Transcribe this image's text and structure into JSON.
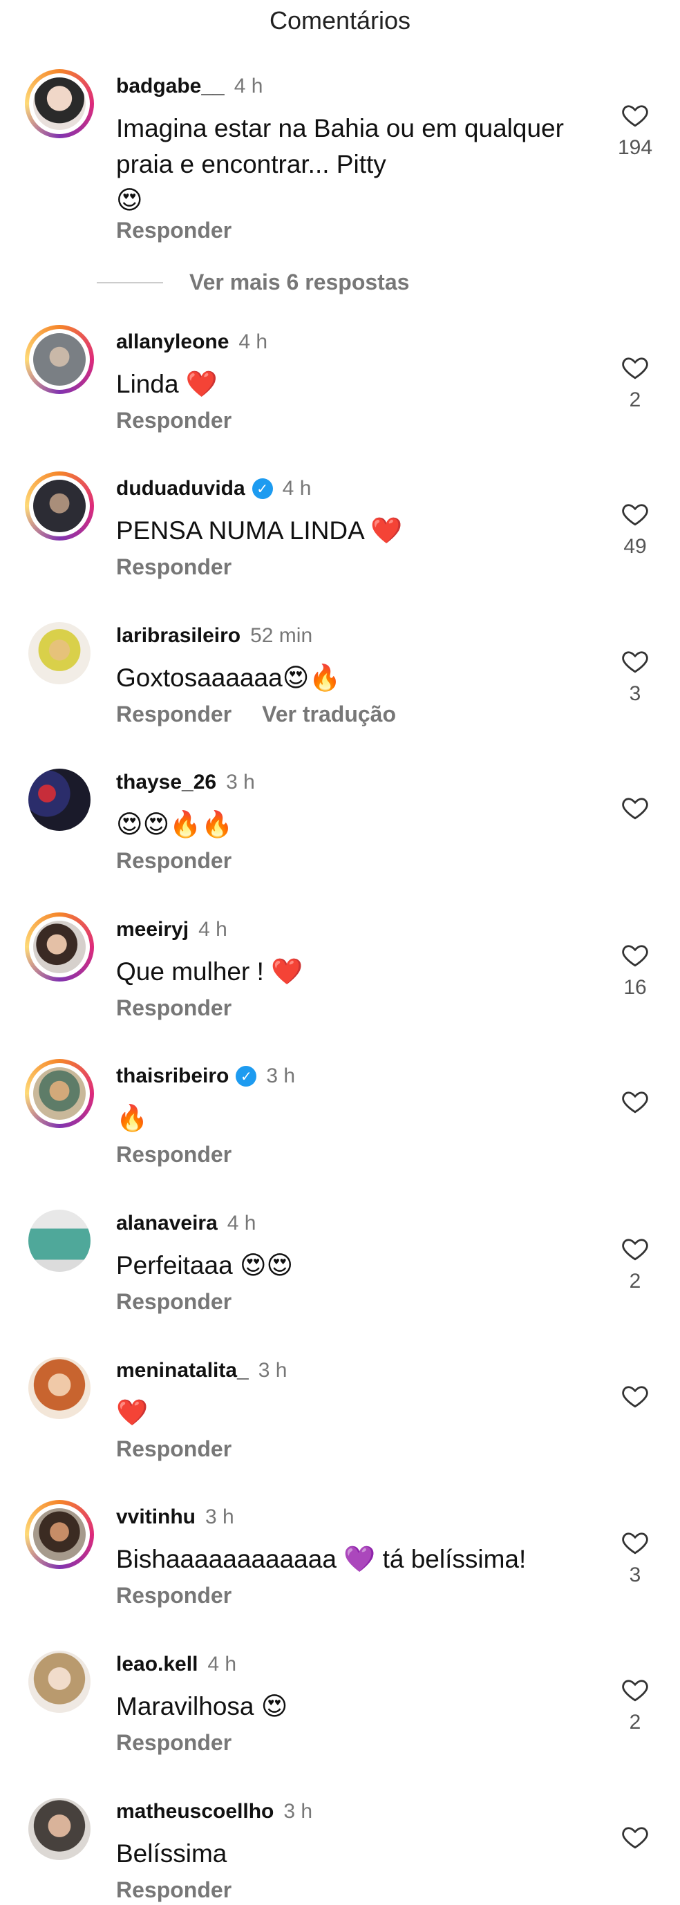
{
  "header": {
    "title": "Comentários"
  },
  "more_replies": "Ver mais 6 respostas",
  "reply_label": "Responder",
  "translate_label": "Ver tradução",
  "comments": [
    {
      "username": "badgabe__",
      "time": "4 h",
      "verified": false,
      "text": "Imagina estar na Bahia ou em qualquer praia e encontrar... Pitty",
      "emoji_line": "😍",
      "likes": "194"
    },
    {
      "username": "allanyleone",
      "time": "4 h",
      "verified": false,
      "text": "Linda",
      "emoji": "❤️",
      "likes": "2"
    },
    {
      "username": "duduaduvida",
      "time": "4 h",
      "verified": true,
      "text": "PENSA NUMA LINDA",
      "emoji": "❤️",
      "likes": "49"
    },
    {
      "username": "laribrasileiro",
      "time": "52 min",
      "verified": false,
      "text": "Goxtosaaaaaa",
      "emoji": "😍🔥",
      "likes": "3"
    },
    {
      "username": "thayse_26",
      "time": "3 h",
      "verified": false,
      "text": "",
      "emoji": "😍😍🔥🔥",
      "likes": ""
    },
    {
      "username": "meeiryj",
      "time": "4 h",
      "verified": false,
      "text": "Que mulher !",
      "emoji": "❤️",
      "likes": "16"
    },
    {
      "username": "thaisribeiro",
      "time": "3 h",
      "verified": true,
      "text": "",
      "emoji": "🔥",
      "likes": ""
    },
    {
      "username": "alanaveira",
      "time": "4 h",
      "verified": false,
      "text": "Perfeitaaa",
      "emoji": "😍😍",
      "likes": "2"
    },
    {
      "username": "meninatalita_",
      "time": "3 h",
      "verified": false,
      "text": "",
      "emoji": "❤️",
      "likes": ""
    },
    {
      "username": "vvitinhu",
      "time": "3 h",
      "verified": false,
      "text": "Bishaaaaaaaaaaaa",
      "emoji": "💜",
      "text_after": "tá belíssima!",
      "likes": "3"
    },
    {
      "username": "leao.kell",
      "time": "4 h",
      "verified": false,
      "text": "Maravilhosa",
      "emoji": "😍",
      "likes": "2"
    },
    {
      "username": "matheuscoellho",
      "time": "3 h",
      "verified": false,
      "text": "Belíssima",
      "emoji": "",
      "likes": ""
    }
  ],
  "colors": {
    "verified": "#1d9bf0",
    "muted": "#777777"
  }
}
